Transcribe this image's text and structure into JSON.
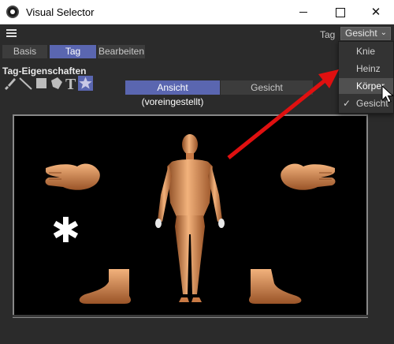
{
  "window": {
    "title": "Visual Selector",
    "minimize_label": "",
    "maximize_label": "",
    "close_label": "✕"
  },
  "header": {
    "tag_label": "Tag",
    "tag_select_value": "Gesicht",
    "chevron": "⌄"
  },
  "tabs": [
    {
      "label": "Basis",
      "active": false
    },
    {
      "label": "Tag",
      "active": true
    },
    {
      "label": "Bearbeiten",
      "active": false
    }
  ],
  "section": {
    "title": "Tag-Eigenschaften"
  },
  "toolbar": {
    "icons": [
      "brush-icon",
      "line-icon",
      "square-icon",
      "polygon-icon",
      "text-icon",
      "star-icon"
    ],
    "text_icon_glyph": "T"
  },
  "view_buttons": [
    {
      "label": "Ansicht (voreingestellt)",
      "active": true
    },
    {
      "label": "Gesicht",
      "active": false
    }
  ],
  "canvas": {
    "asterisk": "✱",
    "figure_colors": {
      "skin": "#d98b52",
      "skin_light": "#f2b27c",
      "skin_dark": "#8a4a22",
      "background": "#000000"
    }
  },
  "dropdown": {
    "items": [
      {
        "label": "Knie",
        "checked": false,
        "highlighted": false
      },
      {
        "label": "Heinz",
        "checked": false,
        "highlighted": false
      },
      {
        "label": "Körper",
        "checked": false,
        "highlighted": true
      },
      {
        "label": "Gesicht",
        "checked": true,
        "highlighted": false
      }
    ],
    "check_glyph": "✓"
  },
  "colors": {
    "accent": "#5a66b0",
    "arrow": "#e01010",
    "panel_bg": "#2b2b2b"
  }
}
